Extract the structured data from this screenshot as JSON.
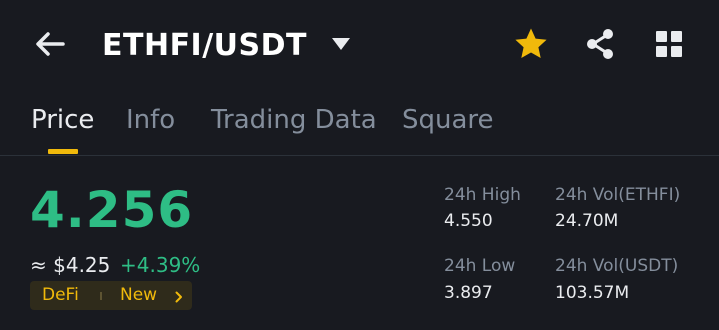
{
  "header": {
    "title": "ETHFI/USDT",
    "icons": {
      "back": "arrow-left-icon",
      "dropdown": "caret-down-icon",
      "favorite": "star-icon",
      "share": "share-icon",
      "more": "grid-icon"
    }
  },
  "tabs": [
    {
      "label": "Price",
      "active": true
    },
    {
      "label": "Info",
      "active": false
    },
    {
      "label": "Trading Data",
      "active": false
    },
    {
      "label": "Square",
      "active": false
    }
  ],
  "price": {
    "last": "4.256",
    "fiat": "≈ $4.25",
    "change": "+4.39%"
  },
  "tags": {
    "category": "DeFi",
    "status": "New"
  },
  "stats": {
    "high": {
      "label": "24h High",
      "value": "4.550"
    },
    "low": {
      "label": "24h Low",
      "value": "3.897"
    },
    "vol_base": {
      "label": "24h Vol(ETHFI)",
      "value": "24.70M"
    },
    "vol_quote": {
      "label": "24h Vol(USDT)",
      "value": "103.57M"
    }
  },
  "colors": {
    "background": "#181a20",
    "up": "#2ebd85",
    "accent": "#f0b90b",
    "muted": "#848e9c",
    "text": "#eaecef"
  }
}
